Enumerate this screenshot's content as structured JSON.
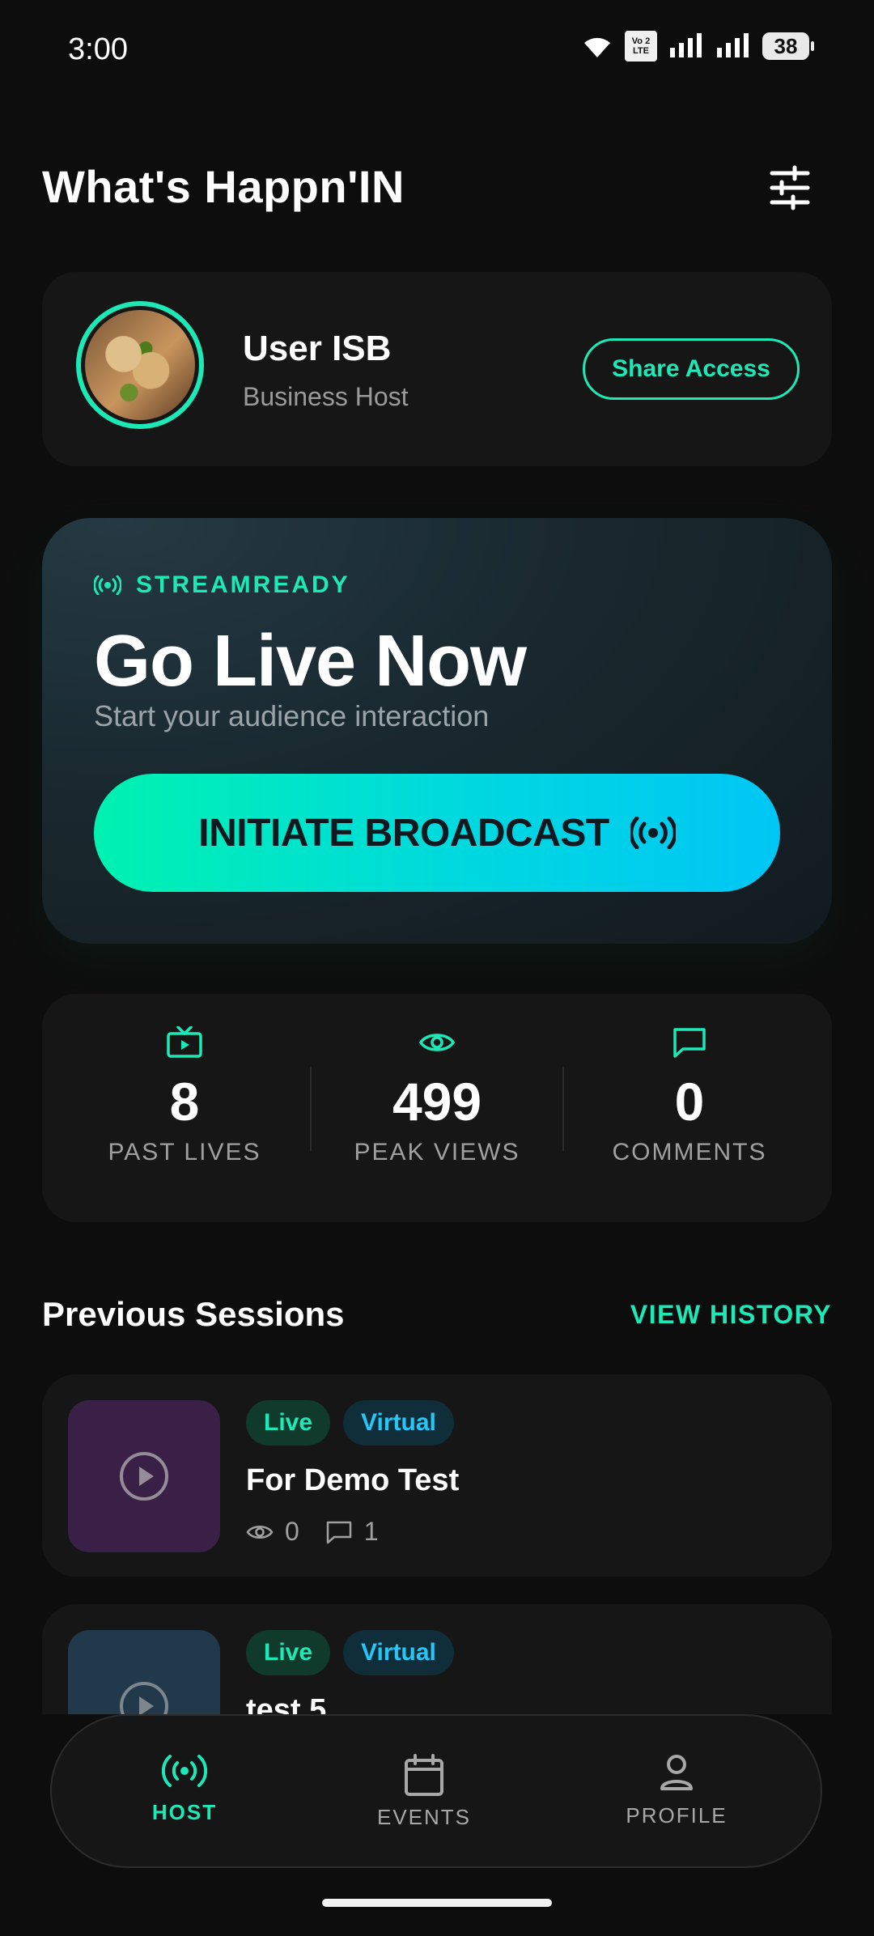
{
  "status_bar": {
    "time": "3:00",
    "battery": "38",
    "volte_top": "Vo 2",
    "volte_bottom": "LTE"
  },
  "header": {
    "title": "What's Happn'IN"
  },
  "user": {
    "name": "User ISB",
    "role": "Business Host",
    "share_label": "Share Access"
  },
  "live_card": {
    "status_label": "STREAMREADY",
    "title": "Go Live Now",
    "subtitle": "Start your audience interaction",
    "button_label": "INITIATE BROADCAST"
  },
  "stats": [
    {
      "value": "8",
      "label": "PAST LIVES",
      "icon": "tv-icon"
    },
    {
      "value": "499",
      "label": "PEAK VIEWS",
      "icon": "eye-icon"
    },
    {
      "value": "0",
      "label": "COMMENTS",
      "icon": "comment-icon"
    }
  ],
  "sessions_section": {
    "title": "Previous Sessions",
    "link": "VIEW HISTORY"
  },
  "sessions": [
    {
      "badges": [
        "Live",
        "Virtual"
      ],
      "title": "For Demo Test",
      "views": "0",
      "comments": "1",
      "thumb_color": "#3a2046"
    },
    {
      "badges": [
        "Live",
        "Virtual"
      ],
      "title": "test 5",
      "thumb_color": "#21394a"
    }
  ],
  "nav": [
    {
      "label": "HOST",
      "icon": "broadcast-icon",
      "active": true
    },
    {
      "label": "EVENTS",
      "icon": "calendar-icon",
      "active": false
    },
    {
      "label": "PROFILE",
      "icon": "person-icon",
      "active": false
    }
  ],
  "colors": {
    "accent": "#1de9b6",
    "accent_blue": "#26c6f7",
    "background": "#0d0d0d",
    "card": "#161616"
  }
}
